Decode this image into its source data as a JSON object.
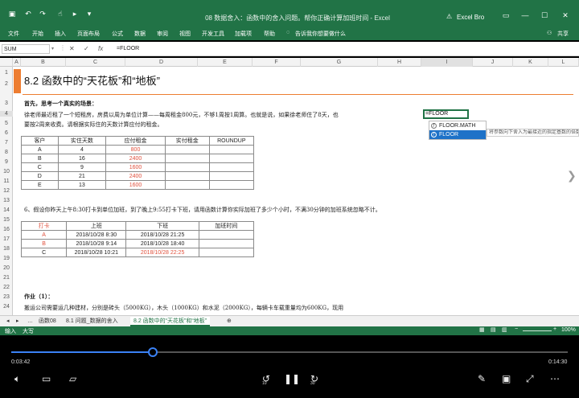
{
  "window": {
    "title": "08 数据舍入：函数中的舍入问题。帮你正确计算加班时间 - Excel",
    "user": "Excel Bro"
  },
  "quick_access": [
    "save-icon",
    "undo-icon",
    "redo-icon",
    "touch-icon",
    "record-icon",
    "customize-icon"
  ],
  "ribbon": {
    "tabs": [
      "文件",
      "开始",
      "插入",
      "页面布局",
      "公式",
      "数据",
      "审阅",
      "视图",
      "开发工具",
      "加载项",
      "帮助"
    ],
    "tell_me": "告诉我你想要做什么",
    "share": "共享"
  },
  "formula_bar": {
    "name_box": "SUM",
    "cancel": "✕",
    "enter": "✓",
    "fx": "fx",
    "formula": "=FLOOR"
  },
  "columns": [
    "A",
    "B",
    "C",
    "D",
    "E",
    "F",
    "G",
    "H",
    "I",
    "J",
    "K",
    "L"
  ],
  "rows": [
    "1",
    "2",
    "3",
    "4",
    "5",
    "6",
    "7",
    "8",
    "9",
    "10",
    "11",
    "12",
    "13",
    "14",
    "15",
    "16",
    "17",
    "18",
    "19",
    "20",
    "21",
    "22",
    "23",
    "24"
  ],
  "sheet": {
    "heading": "8.2 函数中的“天花板”和“地板”",
    "intro_title": "首先，思考一个真实的场景：",
    "intro_line1": "徐老师最近租了一个短租房，房费以周为单位计算——每周租金800元，不够1周按1周算。也就是说，如果徐老师住了8天，也",
    "intro_line2": "要按2周来收费。请根据实际住的天数计算应付的租金。",
    "rent_table": {
      "headers": [
        "客户",
        "实住天数",
        "应付租金",
        "实付租金",
        "ROUNDUP"
      ],
      "rows": [
        [
          "A",
          "4",
          "800",
          "",
          ""
        ],
        [
          "B",
          "16",
          "2400",
          "",
          ""
        ],
        [
          "C",
          "9",
          "1600",
          "",
          ""
        ],
        [
          "D",
          "21",
          "2400",
          "",
          ""
        ],
        [
          "E",
          "13",
          "1600",
          "",
          ""
        ]
      ]
    },
    "q6": "6、假设你昨天上午8:30打卡到单位加班，到了晚上9:55打卡下班，请用函数计算你实际加班了多少个小时，不满30分钟的加班系统忽略不计。",
    "time_table": {
      "headers": [
        "打卡",
        "上班",
        "下班",
        "加班时间"
      ],
      "rows": [
        [
          "A",
          "2018/10/28 8:30",
          "2018/10/28 21:25",
          ""
        ],
        [
          "B",
          "2018/10/28  9:14",
          "2018/10/28 18:40",
          ""
        ],
        [
          "C",
          "2018/10/28 10:21",
          "2018/10/28 22:25",
          ""
        ]
      ]
    },
    "hw_title": "作业（1）：",
    "hw_line": "搬运公司需要运几种建材，分别是砖头（5000KG），木头（1000KG）和水泥（2000KG），每辆卡车载重量均为600KG，现用"
  },
  "editing_cell": "=FLOOR",
  "autocomplete": {
    "items": [
      "FLOOR.MATH",
      "FLOOR"
    ],
    "tooltip": "将参数向下舍入为最接近的指定基数的倍数"
  },
  "sheet_tabs": [
    "函数08",
    "8.1 问题_数据的舍入",
    "8.2 函数中的“天花板”和“地板”"
  ],
  "status": {
    "mode": "输入",
    "caps": "大写",
    "zoom": "100%"
  },
  "player": {
    "current": "0:03:42",
    "total": "0:14:30",
    "progress": 0.255,
    "skip_back": "10",
    "skip_fwd": "30"
  },
  "colors": {
    "excel_green": "#217346",
    "accent_orange": "#ed7d31",
    "value_red": "#e0503c",
    "progress_blue": "#3b82f6"
  }
}
